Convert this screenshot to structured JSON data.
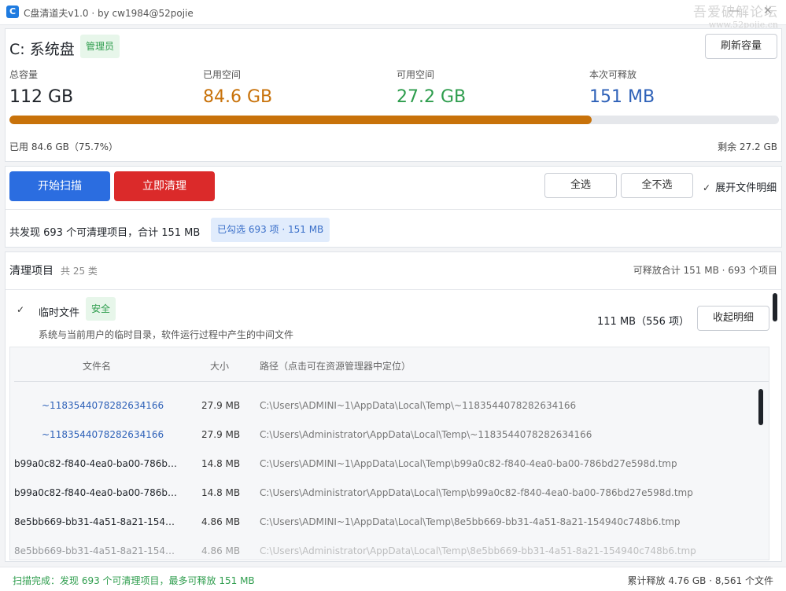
{
  "window": {
    "title": "C盘清道夫v1.0 · by cw1984@52pojie",
    "icon_letter": "C",
    "watermark_line1": "吾爱破解论坛",
    "watermark_line2": "www.52pojie.cn",
    "minimize_glyph": "—",
    "close_glyph": "✕"
  },
  "disk": {
    "title": "C: 系统盘",
    "role_badge": "管理员",
    "refresh_label": "刷新容量",
    "stats": [
      {
        "label": "总容量",
        "value": "112 GB",
        "color": "#1f2329"
      },
      {
        "label": "已用空间",
        "value": "84.6 GB",
        "color": "#c8720a"
      },
      {
        "label": "可用空间",
        "value": "27.2 GB",
        "color": "#2e9d4d"
      },
      {
        "label": "本次可释放",
        "value": "151 MB",
        "color": "#2e61b8"
      }
    ],
    "used_fraction": 0.757,
    "used_text": "已用 84.6 GB（75.7%）",
    "remaining_text": "剩余 27.2 GB"
  },
  "actions": {
    "scan_label": "开始扫描",
    "clean_label": "立即清理",
    "select_all_label": "全选",
    "select_none_label": "全不选",
    "expand_details_label": "展开文件明细",
    "summary": "共发现 693 个可清理项目，合计 151 MB",
    "selected_badge": "已勾选 693 项 · 151 MB",
    "colors": {
      "scan": "#2b6de0",
      "clean": "#db2a2a"
    }
  },
  "list": {
    "title": "清理项目",
    "count": "共 25 类",
    "total": "可释放合计 151 MB · 693 个项目",
    "category": {
      "name": "临时文件",
      "safety_badge": "安全",
      "description": "系统与当前用户的临时目录，软件运行过程中产生的中间文件",
      "size": "111 MB（556 项）",
      "collapse_label": "收起明细"
    },
    "table": {
      "headers": {
        "name": "文件名",
        "size": "大小",
        "path": "路径（点击可在资源管理器中定位）"
      },
      "rows": [
        {
          "name": "~1183544078282634166",
          "size": "27.9 MB",
          "path": "C:\\Users\\ADMINI~1\\AppData\\Local\\Temp\\~1183544078282634166"
        },
        {
          "name": "~1183544078282634166",
          "size": "27.9 MB",
          "path": "C:\\Users\\Administrator\\AppData\\Local\\Temp\\~1183544078282634166"
        },
        {
          "name": "b99a0c82-f840-4ea0-ba00-786bd2...",
          "size": "14.8 MB",
          "path": "C:\\Users\\ADMINI~1\\AppData\\Local\\Temp\\b99a0c82-f840-4ea0-ba00-786bd27e598d.tmp"
        },
        {
          "name": "b99a0c82-f840-4ea0-ba00-786bd2...",
          "size": "14.8 MB",
          "path": "C:\\Users\\Administrator\\AppData\\Local\\Temp\\b99a0c82-f840-4ea0-ba00-786bd27e598d.tmp"
        },
        {
          "name": "8e5bb669-bb31-4a51-8a21-15494...",
          "size": "4.86 MB",
          "path": "C:\\Users\\ADMINI~1\\AppData\\Local\\Temp\\8e5bb669-bb31-4a51-8a21-154940c748b6.tmp"
        },
        {
          "name": "8e5bb669-bb31-4a51-8a21-15494...",
          "size": "4.86 MB",
          "path": "C:\\Users\\Administrator\\AppData\\Local\\Temp\\8e5bb669-bb31-4a51-8a21-154940c748b6.tmp"
        }
      ]
    }
  },
  "status": {
    "left": "扫描完成：发现 693 个可清理项目，最多可释放 151 MB",
    "right": "累计释放 4.76 GB · 8,561 个文件"
  }
}
